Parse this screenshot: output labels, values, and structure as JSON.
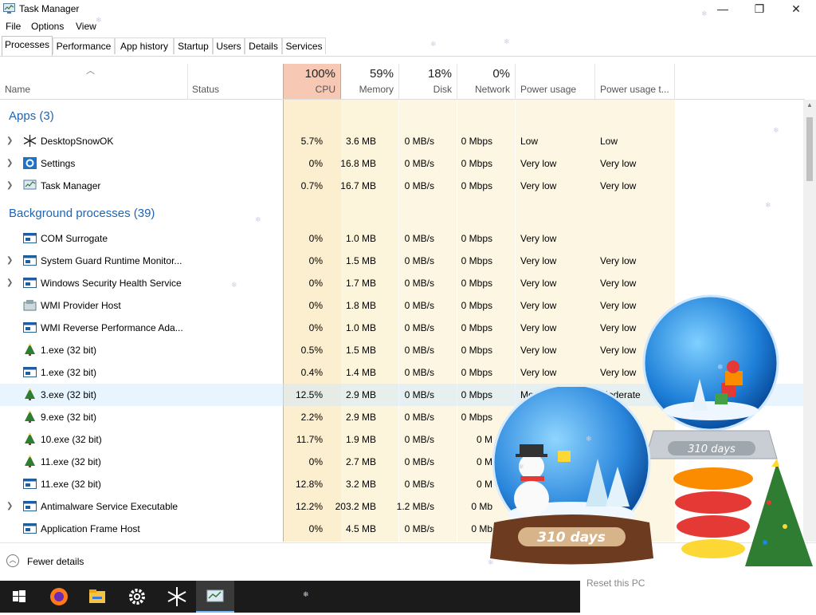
{
  "window": {
    "title": "Task Manager",
    "controls": {
      "minimize": "—",
      "maximize": "❐",
      "close": "✕"
    }
  },
  "menu": [
    "File",
    "Options",
    "View"
  ],
  "tabs": [
    "Processes",
    "Performance",
    "App history",
    "Startup",
    "Users",
    "Details",
    "Services"
  ],
  "active_tab": "Processes",
  "columns": {
    "name": "Name",
    "status": "Status",
    "cpu": {
      "pct": "100%",
      "label": "CPU"
    },
    "memory": {
      "pct": "59%",
      "label": "Memory"
    },
    "disk": {
      "pct": "18%",
      "label": "Disk"
    },
    "network": {
      "pct": "0%",
      "label": "Network"
    },
    "power": "Power usage",
    "power_trend": "Power usage t..."
  },
  "groups": {
    "apps": "Apps (3)",
    "background": "Background processes (39)"
  },
  "apps": [
    {
      "name": "DesktopSnowOK",
      "icon": "snowflake-icon",
      "expandable": true,
      "cpu": "5.7%",
      "memory": "3.6 MB",
      "disk": "0 MB/s",
      "network": "0 Mbps",
      "power": "Low",
      "trend": "Low"
    },
    {
      "name": "Settings",
      "icon": "gear-icon",
      "expandable": true,
      "cpu": "0%",
      "memory": "16.8 MB",
      "disk": "0 MB/s",
      "network": "0 Mbps",
      "power": "Very low",
      "trend": "Very low"
    },
    {
      "name": "Task Manager",
      "icon": "task-manager-icon",
      "expandable": true,
      "cpu": "0.7%",
      "memory": "16.7 MB",
      "disk": "0 MB/s",
      "network": "0 Mbps",
      "power": "Very low",
      "trend": "Very low"
    }
  ],
  "background": [
    {
      "name": "COM Surrogate",
      "icon": "window-icon",
      "expandable": false,
      "cpu": "0%",
      "memory": "1.0 MB",
      "disk": "0 MB/s",
      "network": "0 Mbps",
      "power": "Very low",
      "trend": ""
    },
    {
      "name": "System Guard Runtime Monitor...",
      "icon": "window-icon",
      "expandable": true,
      "cpu": "0%",
      "memory": "1.5 MB",
      "disk": "0 MB/s",
      "network": "0 Mbps",
      "power": "Very low",
      "trend": "Very low"
    },
    {
      "name": "Windows Security Health Service",
      "icon": "window-icon",
      "expandable": true,
      "cpu": "0%",
      "memory": "1.7 MB",
      "disk": "0 MB/s",
      "network": "0 Mbps",
      "power": "Very low",
      "trend": "Very low"
    },
    {
      "name": "WMI Provider Host",
      "icon": "wmi-icon",
      "expandable": false,
      "cpu": "0%",
      "memory": "1.8 MB",
      "disk": "0 MB/s",
      "network": "0 Mbps",
      "power": "Very low",
      "trend": "Very low"
    },
    {
      "name": "WMI Reverse Performance Ada...",
      "icon": "window-icon",
      "expandable": false,
      "cpu": "0%",
      "memory": "1.0 MB",
      "disk": "0 MB/s",
      "network": "0 Mbps",
      "power": "Very low",
      "trend": "Very low"
    },
    {
      "name": "1.exe (32 bit)",
      "icon": "tree-icon",
      "expandable": false,
      "cpu": "0.5%",
      "memory": "1.5 MB",
      "disk": "0 MB/s",
      "network": "0 Mbps",
      "power": "Very low",
      "trend": "Very low"
    },
    {
      "name": "1.exe (32 bit)",
      "icon": "window-icon",
      "expandable": false,
      "cpu": "0.4%",
      "memory": "1.4 MB",
      "disk": "0 MB/s",
      "network": "0 Mbps",
      "power": "Very low",
      "trend": "Very low"
    },
    {
      "name": "3.exe (32 bit)",
      "icon": "tree-icon",
      "expandable": false,
      "cpu": "12.5%",
      "memory": "2.9 MB",
      "disk": "0 MB/s",
      "network": "0 Mbps",
      "power": "Mo",
      "trend": "Moderate",
      "selected": true
    },
    {
      "name": "9.exe (32 bit)",
      "icon": "tree-icon",
      "expandable": false,
      "cpu": "2.2%",
      "memory": "2.9 MB",
      "disk": "0 MB/s",
      "network": "0 Mbps",
      "power": "",
      "trend": ""
    },
    {
      "name": "10.exe (32 bit)",
      "icon": "tree-icon",
      "expandable": false,
      "cpu": "11.7%",
      "memory": "1.9 MB",
      "disk": "0 MB/s",
      "network": "0 M",
      "power": "",
      "trend": ""
    },
    {
      "name": "11.exe (32 bit)",
      "icon": "tree-icon",
      "expandable": false,
      "cpu": "0%",
      "memory": "2.7 MB",
      "disk": "0 MB/s",
      "network": "0 M",
      "power": "",
      "trend": ""
    },
    {
      "name": "11.exe (32 bit)",
      "icon": "window-icon",
      "expandable": false,
      "cpu": "12.8%",
      "memory": "3.2 MB",
      "disk": "0 MB/s",
      "network": "0 M",
      "power": "",
      "trend": ""
    },
    {
      "name": "Antimalware Service Executable",
      "icon": "window-icon",
      "expandable": true,
      "cpu": "12.2%",
      "memory": "203.2 MB",
      "disk": "1.2 MB/s",
      "network": "0 Mb",
      "power": "",
      "trend": ""
    },
    {
      "name": "Application Frame Host",
      "icon": "window-icon",
      "expandable": false,
      "cpu": "0%",
      "memory": "4.5 MB",
      "disk": "0 MB/s",
      "network": "0 Mb",
      "power": "",
      "trend": ""
    }
  ],
  "footer": {
    "label": "Fewer details"
  },
  "overlay": {
    "globe_text_1": "310 days",
    "globe_text_2": "310 days"
  },
  "behind_text": "Reset this PC",
  "taskbar": [
    "windows-start-icon",
    "firefox-icon",
    "file-explorer-icon",
    "settings-gear-icon",
    "desktopsnowok-icon",
    "task-manager-icon"
  ]
}
